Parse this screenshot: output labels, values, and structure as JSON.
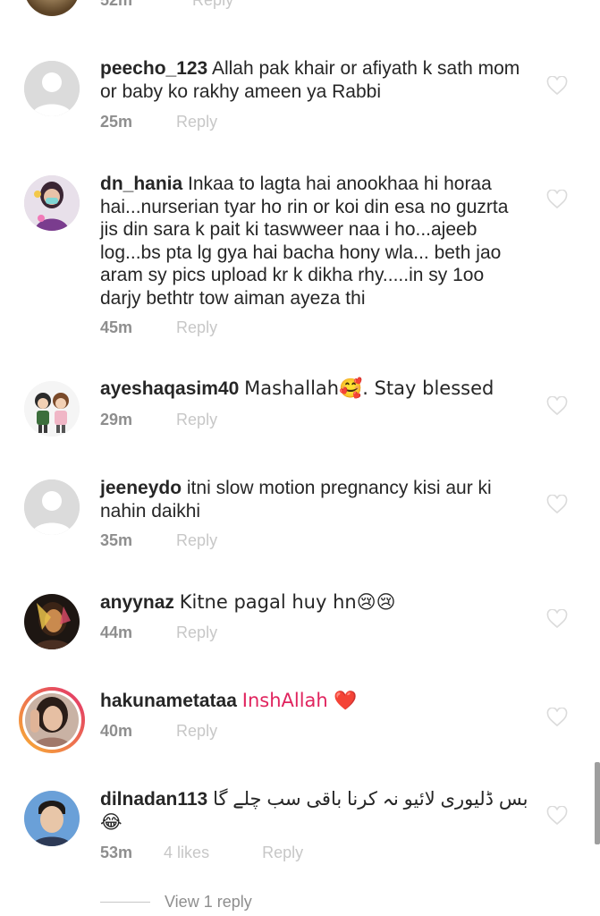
{
  "top_partial": {
    "time": "52m",
    "reply_label": "Reply"
  },
  "comments": [
    {
      "username": "peecho_123",
      "text": "Allah pak khair or afiyath k sath mom or baby ko rakhy ameen ya Rabbi",
      "time": "25m",
      "reply_label": "Reply"
    },
    {
      "username": "dn_hania",
      "text": "Inkaa to lagta hai anookhaa hi horaa hai...nurserian tyar ho rin or koi din esa no guzrta jis din sara k pait ki taswweer naa i ho...ajeeb log...bs pta lg gya hai bacha hony wla... beth jao aram sy pics upload kr k dikha rhy.....in sy 1oo darjy bethtr tow aiman ayeza thi",
      "time": "45m",
      "reply_label": "Reply"
    },
    {
      "username": "ayeshaqasim40",
      "text": "Mashallah🥰. Stay blessed",
      "time": "29m",
      "reply_label": "Reply"
    },
    {
      "username": "jeeneydo",
      "text": "itni slow motion pregnancy kisi aur ki nahin daikhi",
      "time": "35m",
      "reply_label": "Reply"
    },
    {
      "username": "anyynaz",
      "text": "Kitne pagal huy hn😢😢",
      "time": "44m",
      "reply_label": "Reply"
    },
    {
      "username": "hakunametataa",
      "text": "InshAllah ❤️",
      "time": "40m",
      "reply_label": "Reply"
    },
    {
      "username": "dilnadan113",
      "text": "بس ڈلیوری لائیو نہ کرنا باقی سب چلے گا",
      "text_line2": "😂",
      "time": "53m",
      "likes": "4 likes",
      "reply_label": "Reply"
    }
  ],
  "view_replies_label": "View 1 reply",
  "icons": {
    "heart": "heart-outline-icon",
    "default_avatar": "default-avatar-icon"
  },
  "colors": {
    "text": "#262626",
    "secondary": "#8e8e8e",
    "muted": "#c7c7c7",
    "heart_stroke": "#dbdbdb"
  }
}
